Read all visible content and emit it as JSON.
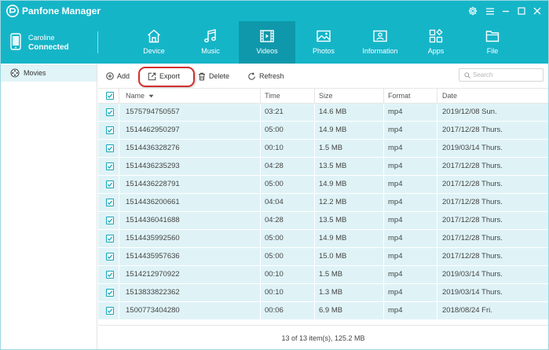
{
  "app": {
    "title": "Panfone Manager"
  },
  "window_controls": [
    {
      "name": "settings-button",
      "icon": "gear-icon"
    },
    {
      "name": "menu-button",
      "icon": "hamburger-icon"
    },
    {
      "name": "minimize-button",
      "icon": "minimize-icon"
    },
    {
      "name": "maximize-button",
      "icon": "maximize-icon"
    },
    {
      "name": "close-button",
      "icon": "close-icon"
    }
  ],
  "device": {
    "name": "Caroline",
    "status": "Connected"
  },
  "nav": {
    "tabs": [
      {
        "label": "Device",
        "icon": "home-icon"
      },
      {
        "label": "Music",
        "icon": "music-note-icon"
      },
      {
        "label": "Videos",
        "icon": "film-icon"
      },
      {
        "label": "Photos",
        "icon": "image-icon"
      },
      {
        "label": "Information",
        "icon": "contact-card-icon"
      },
      {
        "label": "Apps",
        "icon": "apps-grid-icon"
      },
      {
        "label": "File",
        "icon": "folder-icon"
      }
    ],
    "active": "Videos"
  },
  "sidebar": {
    "items": [
      {
        "label": "Movies",
        "icon": "film-reel-icon"
      }
    ]
  },
  "toolbar": {
    "add_label": "Add",
    "export_label": "Export",
    "delete_label": "Delete",
    "refresh_label": "Refresh"
  },
  "search": {
    "placeholder": "Search"
  },
  "table": {
    "columns": [
      "Name",
      "Time",
      "Size",
      "Format",
      "Date"
    ],
    "sort_column": "Name",
    "rows": [
      {
        "name": "1575794750557",
        "time": "03:21",
        "size": "14.6 MB",
        "format": "mp4",
        "date": "2019/12/08 Sun."
      },
      {
        "name": "1514462950297",
        "time": "05:00",
        "size": "14.9 MB",
        "format": "mp4",
        "date": "2017/12/28 Thurs."
      },
      {
        "name": "1514436328276",
        "time": "00:10",
        "size": "1.5 MB",
        "format": "mp4",
        "date": "2019/03/14 Thurs."
      },
      {
        "name": "1514436235293",
        "time": "04:28",
        "size": "13.5 MB",
        "format": "mp4",
        "date": "2017/12/28 Thurs."
      },
      {
        "name": "1514436228791",
        "time": "05:00",
        "size": "14.9 MB",
        "format": "mp4",
        "date": "2017/12/28 Thurs."
      },
      {
        "name": "1514436200661",
        "time": "04:04",
        "size": "12.2 MB",
        "format": "mp4",
        "date": "2017/12/28 Thurs."
      },
      {
        "name": "1514436041688",
        "time": "04:28",
        "size": "13.5 MB",
        "format": "mp4",
        "date": "2017/12/28 Thurs."
      },
      {
        "name": "1514435992560",
        "time": "05:00",
        "size": "14.9 MB",
        "format": "mp4",
        "date": "2017/12/28 Thurs."
      },
      {
        "name": "1514435957636",
        "time": "05:00",
        "size": "15.0 MB",
        "format": "mp4",
        "date": "2017/12/28 Thurs."
      },
      {
        "name": "1514212970922",
        "time": "00:10",
        "size": "1.5 MB",
        "format": "mp4",
        "date": "2019/03/14 Thurs."
      },
      {
        "name": "1513833822362",
        "time": "00:10",
        "size": "1.3 MB",
        "format": "mp4",
        "date": "2019/03/14 Thurs."
      },
      {
        "name": "1500773404280",
        "time": "00:06",
        "size": "6.9 MB",
        "format": "mp4",
        "date": "2018/08/24 Fri."
      }
    ]
  },
  "footer": {
    "summary": "13 of 13 item(s), 125.2 MB"
  },
  "colors": {
    "brand": "#15b5c8",
    "brand_active": "#0f98ab",
    "row_selected": "#dff3f7",
    "highlight_ring": "#d32f2f"
  }
}
